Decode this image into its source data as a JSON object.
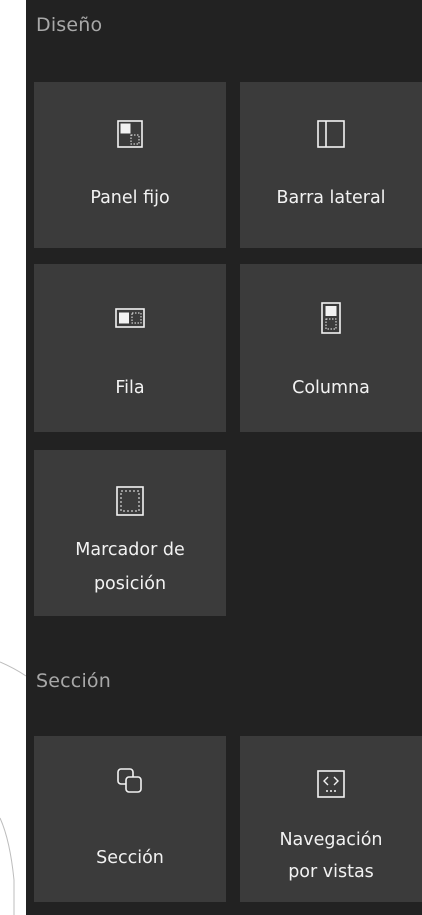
{
  "sections": {
    "layout": {
      "title": "Diseño",
      "items": [
        {
          "label": "Panel fijo",
          "icon": "fixed-panel-icon"
        },
        {
          "label": "Barra lateral",
          "icon": "sidebar-icon"
        },
        {
          "label": "Fila",
          "icon": "row-icon"
        },
        {
          "label": "Columna",
          "icon": "column-icon"
        },
        {
          "label_line1": "Marcador de",
          "label_line2": "posición",
          "icon": "placeholder-icon"
        }
      ]
    },
    "section": {
      "title": "Sección",
      "items": [
        {
          "label": "Sección",
          "icon": "section-icon"
        },
        {
          "label_line1": "Navegación",
          "label_line2": "por vistas",
          "icon": "view-navigation-icon"
        }
      ]
    }
  },
  "colors": {
    "panel_bg": "#222222",
    "tile_bg": "#3b3b3b",
    "title_text": "#a8a8a8",
    "tile_text": "#f2f2f2"
  }
}
